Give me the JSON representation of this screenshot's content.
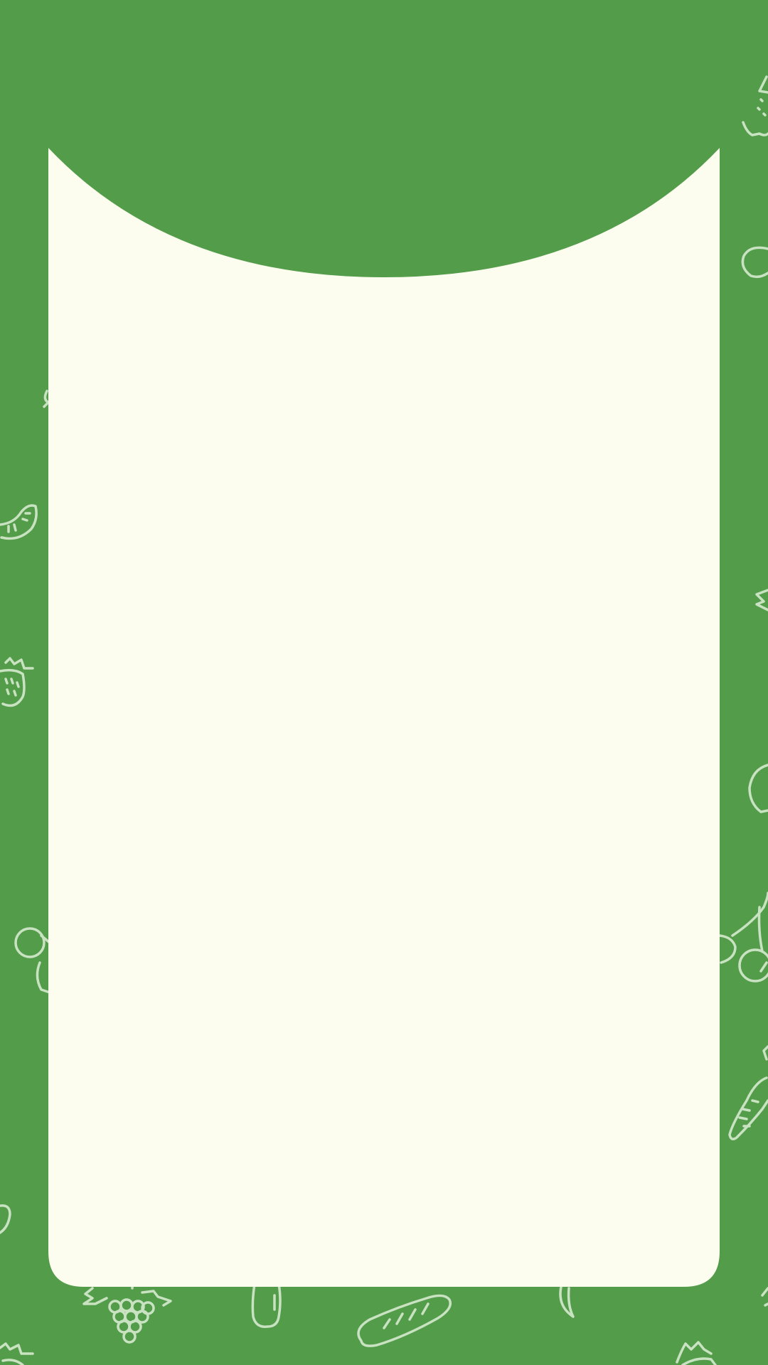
{
  "theme": {
    "background_color": "#539C4A",
    "doodle_color": "#C9E3C2",
    "card_color": "#FCFDEF"
  },
  "background_icons": [
    "pepper-icon",
    "potato-icon",
    "leaf-icon",
    "lime-slice-icon",
    "strawberry-icon",
    "carrot-icon",
    "turnip-icon",
    "cherries-icon",
    "grapes-icon",
    "bottle-icon",
    "baguette-icon",
    "banana-icon"
  ]
}
